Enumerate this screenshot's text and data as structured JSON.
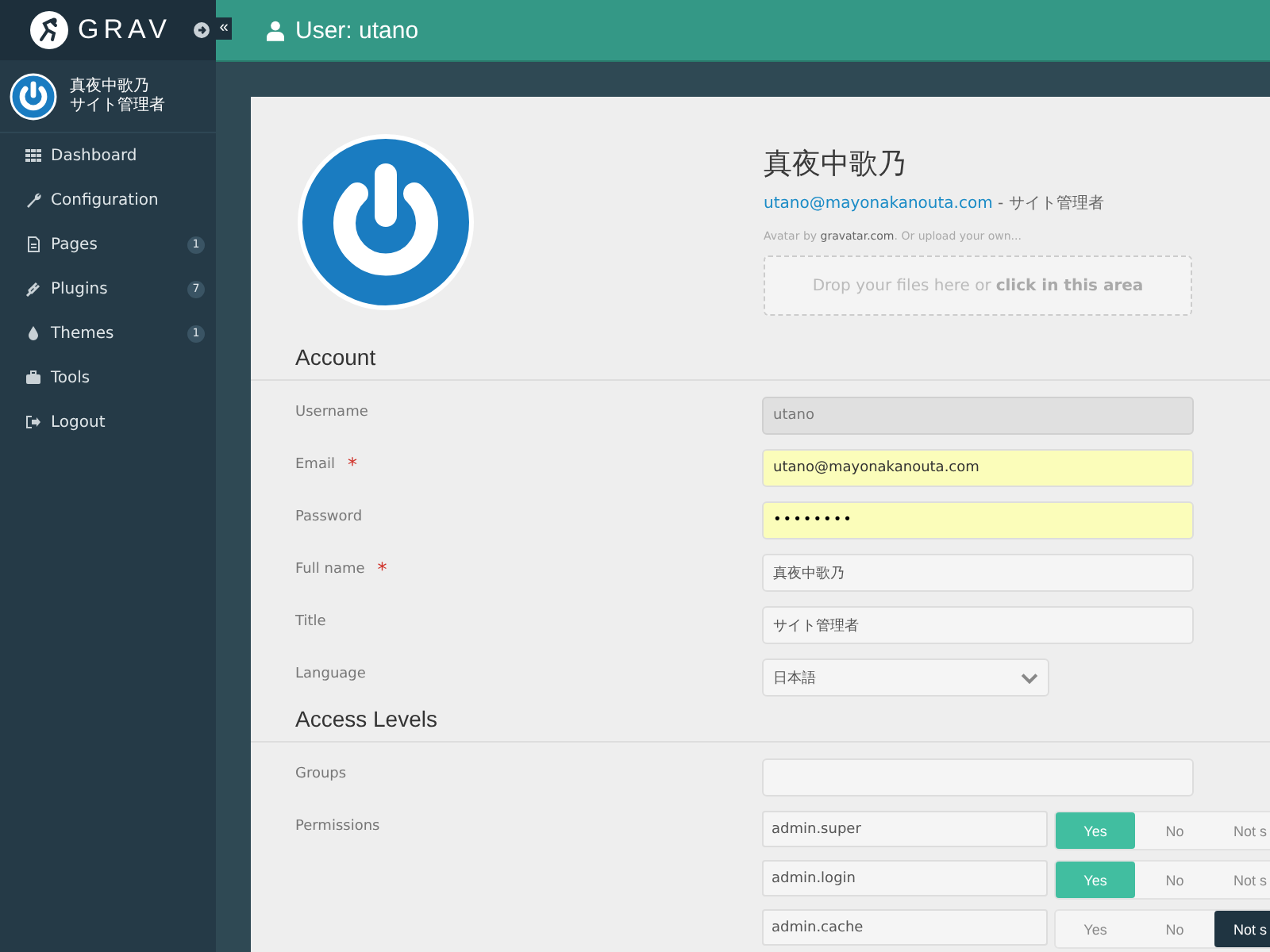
{
  "sidebar": {
    "logo_text": "GRAV",
    "user": {
      "name": "真夜中歌乃",
      "title": "サイト管理者"
    },
    "items": [
      {
        "label": "Dashboard"
      },
      {
        "label": "Configuration"
      },
      {
        "label": "Pages",
        "badge": "1"
      },
      {
        "label": "Plugins",
        "badge": "7"
      },
      {
        "label": "Themes",
        "badge": "1"
      },
      {
        "label": "Tools"
      },
      {
        "label": "Logout"
      }
    ]
  },
  "header": {
    "collapse_glyph": "«",
    "title": "User: utano"
  },
  "profile": {
    "name": "真夜中歌乃",
    "email": "utano@mayonakanouta.com",
    "role": " - サイト管理者",
    "avatar_note_prefix": "Avatar by ",
    "avatar_note_link": "gravatar.com",
    "avatar_note_suffix": ". Or upload your own...",
    "drop_text": "Drop your files here or ",
    "drop_link": "click in this area"
  },
  "sections": [
    {
      "title": "Account",
      "fields": [
        {
          "label": "Username",
          "kind": "text",
          "value": "utano",
          "disabled": true,
          "autofilled": false
        },
        {
          "label": "Email",
          "kind": "text",
          "required_mark": "*",
          "value": "utano@mayonakanouta.com",
          "disabled": false,
          "autofilled": true
        },
        {
          "label": "Password",
          "kind": "password",
          "value": "••••••••",
          "disabled": false,
          "autofilled": true
        },
        {
          "label": "Full name",
          "kind": "text",
          "required_mark": "*",
          "value": "真夜中歌乃",
          "disabled": false,
          "autofilled": false
        },
        {
          "label": "Title",
          "kind": "text",
          "value": "サイト管理者",
          "disabled": false,
          "autofilled": false
        },
        {
          "label": "Language",
          "kind": "select",
          "value": "日本語"
        }
      ]
    },
    {
      "title": "Access Levels",
      "fields": [
        {
          "label": "Groups",
          "kind": "text",
          "disabled": false,
          "autofilled": false
        },
        {
          "label": "Permissions",
          "kind": "permissions",
          "rows": [
            {
              "name": "admin.super",
              "options": [
                {
                  "label": "Yes",
                  "kind": "yes",
                  "selected": true
                },
                {
                  "label": "No",
                  "kind": "no",
                  "selected": false
                },
                {
                  "label": "Not s",
                  "kind": "unset",
                  "selected": false
                }
              ]
            },
            {
              "name": "admin.login",
              "options": [
                {
                  "label": "Yes",
                  "kind": "yes",
                  "selected": true
                },
                {
                  "label": "No",
                  "kind": "no",
                  "selected": false
                },
                {
                  "label": "Not s",
                  "kind": "unset",
                  "selected": false
                }
              ]
            },
            {
              "name": "admin.cache",
              "options": [
                {
                  "label": "Yes",
                  "kind": "yes",
                  "selected": false
                },
                {
                  "label": "No",
                  "kind": "no",
                  "selected": false
                },
                {
                  "label": "Not s",
                  "kind": "unset",
                  "selected": true
                }
              ]
            }
          ]
        }
      ]
    }
  ]
}
